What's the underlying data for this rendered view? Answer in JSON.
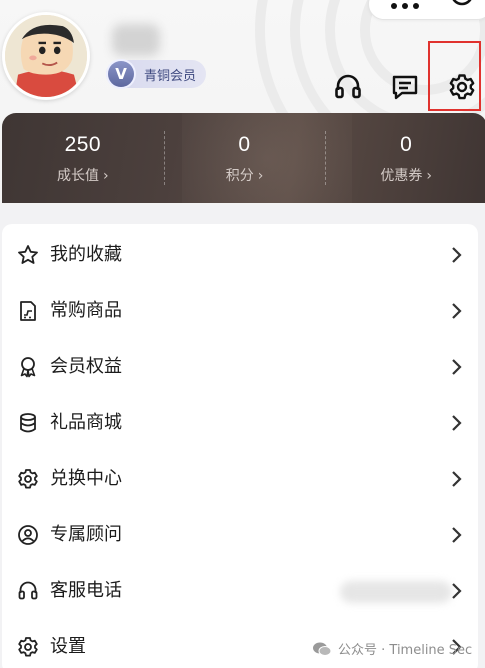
{
  "header": {
    "member_badge": {
      "letter": "V",
      "label": "青铜会员"
    }
  },
  "top_icons": [
    "headset-icon",
    "message-icon",
    "gear-icon"
  ],
  "stats": [
    {
      "value": "250",
      "label": "成长值",
      "arrow": "›"
    },
    {
      "value": "0",
      "label": "积分",
      "arrow": "›"
    },
    {
      "value": "0",
      "label": "优惠券",
      "arrow": "›"
    }
  ],
  "menu": {
    "items": [
      {
        "label": "我的收藏",
        "icon": "star-icon"
      },
      {
        "label": "常购商品",
        "icon": "cart-icon"
      },
      {
        "label": "会员权益",
        "icon": "medal-icon"
      },
      {
        "label": "礼品商城",
        "icon": "database-icon"
      },
      {
        "label": "兑换中心",
        "icon": "gear-icon"
      },
      {
        "label": "专属顾问",
        "icon": "user-circle-icon"
      },
      {
        "label": "客服电话",
        "icon": "headset-icon"
      },
      {
        "label": "设置",
        "icon": "gear-icon"
      }
    ]
  },
  "watermark": {
    "text": "公众号 · Timeline Sec"
  },
  "colors": {
    "stats_bg": "#4c403d",
    "badge_text": "#3f4a80",
    "highlight_box": "#e0322e"
  }
}
